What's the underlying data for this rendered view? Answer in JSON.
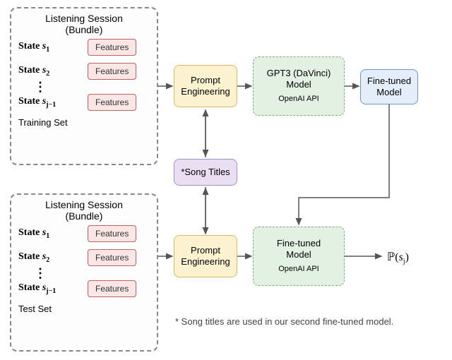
{
  "panels": {
    "train": {
      "title": "Listening Session\n(Bundle)",
      "states": [
        "State s₁",
        "State s₂",
        "State s⋯",
        "State sⱼ₋₁"
      ],
      "feature_label": "Features",
      "foot": "Training Set"
    },
    "test": {
      "title": "Listening Session\n(Bundle)",
      "states": [
        "State s₁",
        "State s₂",
        "State s⋯",
        "State sⱼ₋₁"
      ],
      "feature_label": "Features",
      "foot": "Test Set"
    }
  },
  "blocks": {
    "prompt1": "Prompt\nEngineering",
    "prompt2": "Prompt\nEngineering",
    "songtitles": "*Song Titles",
    "gpt3": {
      "main": "GPT3 (DaVinci)\nModel",
      "sub": "OpenAI API"
    },
    "finetuned": "Fine-tuned\nModel",
    "finetuned2": {
      "main": "Fine-tuned\nModel",
      "sub": "OpenAI API"
    }
  },
  "output_label": "ℙ(sⱼ)",
  "footnote": "* Song titles are used in our second fine-tuned model."
}
